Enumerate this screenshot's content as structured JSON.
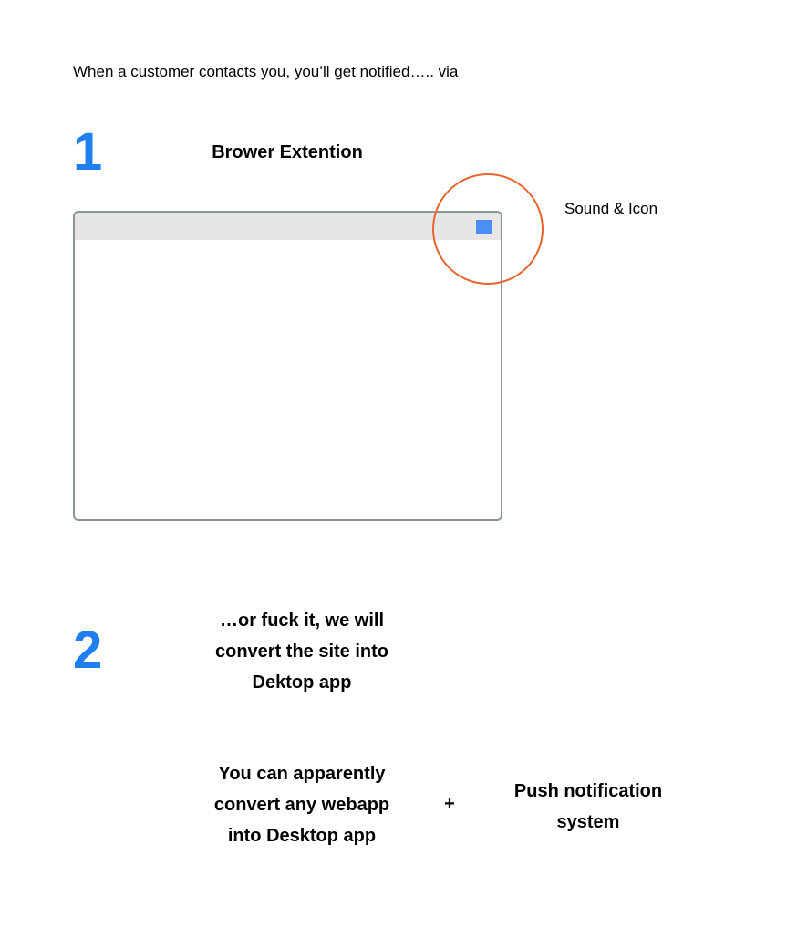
{
  "intro_text": "When a customer contacts you, you’ll get notified….. via",
  "step1": {
    "number": "1",
    "title": "Brower Extention",
    "annotation": "Sound & Icon",
    "accent_color": "#4a8ff7",
    "highlight_color": "#e8642c"
  },
  "step2": {
    "number": "2",
    "title_lines": [
      "…or fuck it, we will",
      "convert the site into",
      "Dektop app"
    ],
    "left_lines": [
      "You can apparently",
      "convert any webapp",
      "into Desktop app"
    ],
    "operator": "+",
    "right_lines": [
      "Push notification",
      "system"
    ]
  },
  "colors": {
    "step_number": "#1f7ff0",
    "window_border": "#8a9597",
    "titlebar": "#e6e6e6"
  }
}
